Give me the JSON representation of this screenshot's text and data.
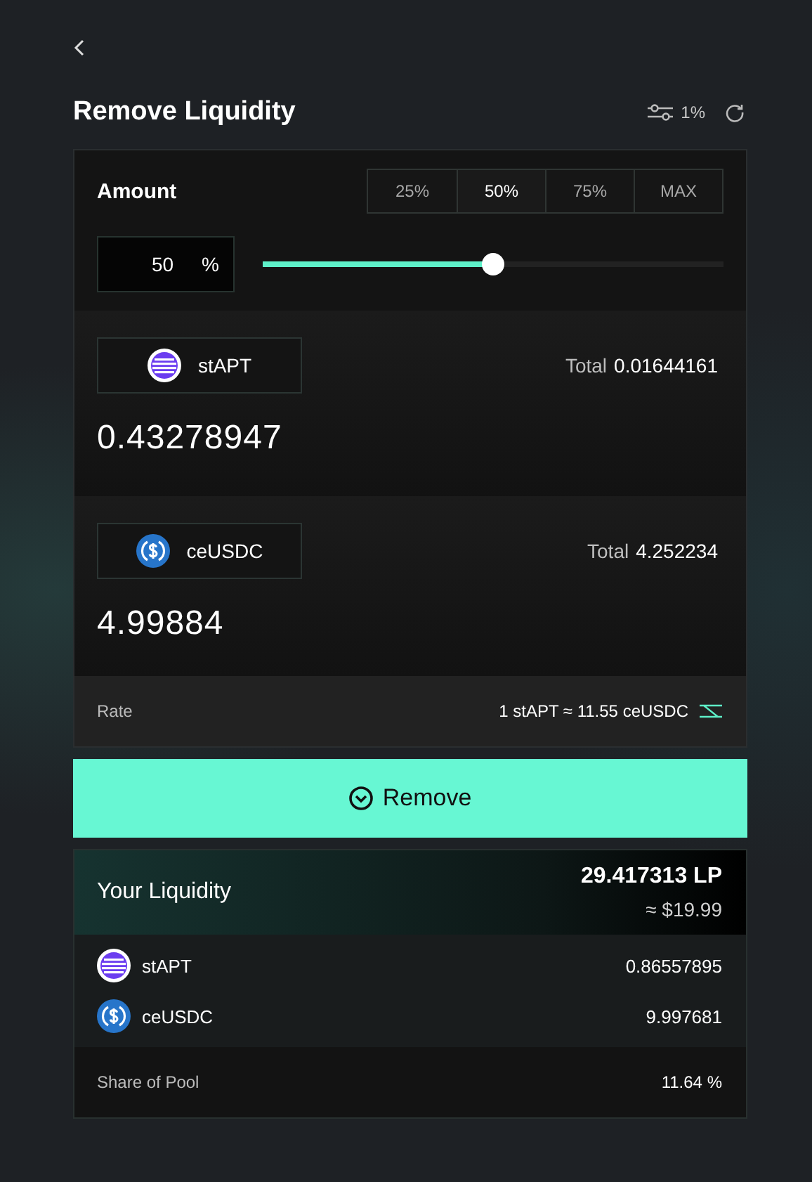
{
  "header": {
    "title": "Remove Liquidity",
    "slippage": "1%"
  },
  "amount": {
    "label": "Amount",
    "presets": [
      {
        "label": "25%",
        "selected": false
      },
      {
        "label": "50%",
        "selected": true
      },
      {
        "label": "75%",
        "selected": false
      },
      {
        "label": "MAX",
        "selected": false
      }
    ],
    "value": "50",
    "unit": "%",
    "level": 0.5
  },
  "tokens": [
    {
      "symbol": "stAPT",
      "kind": "stripes",
      "total_label": "Total",
      "total": "0.01644161",
      "amount": "0.43278947"
    },
    {
      "symbol": "ceUSDC",
      "kind": "dollar",
      "total_label": "Total",
      "total": "4.252234",
      "amount": "4.99884"
    }
  ],
  "rate": {
    "label": "Rate",
    "value": "1 stAPT ≈ 11.55 ceUSDC"
  },
  "remove_button": "Remove",
  "liquidity": {
    "title": "Your Liquidity",
    "lp": "29.417313 LP",
    "usd": "≈ $19.99",
    "holdings": [
      {
        "symbol": "stAPT",
        "kind": "stripes",
        "amount": "0.86557895"
      },
      {
        "symbol": "ceUSDC",
        "kind": "dollar",
        "amount": "9.997681"
      }
    ],
    "share_label": "Share of Pool",
    "share": "11.64 %"
  }
}
